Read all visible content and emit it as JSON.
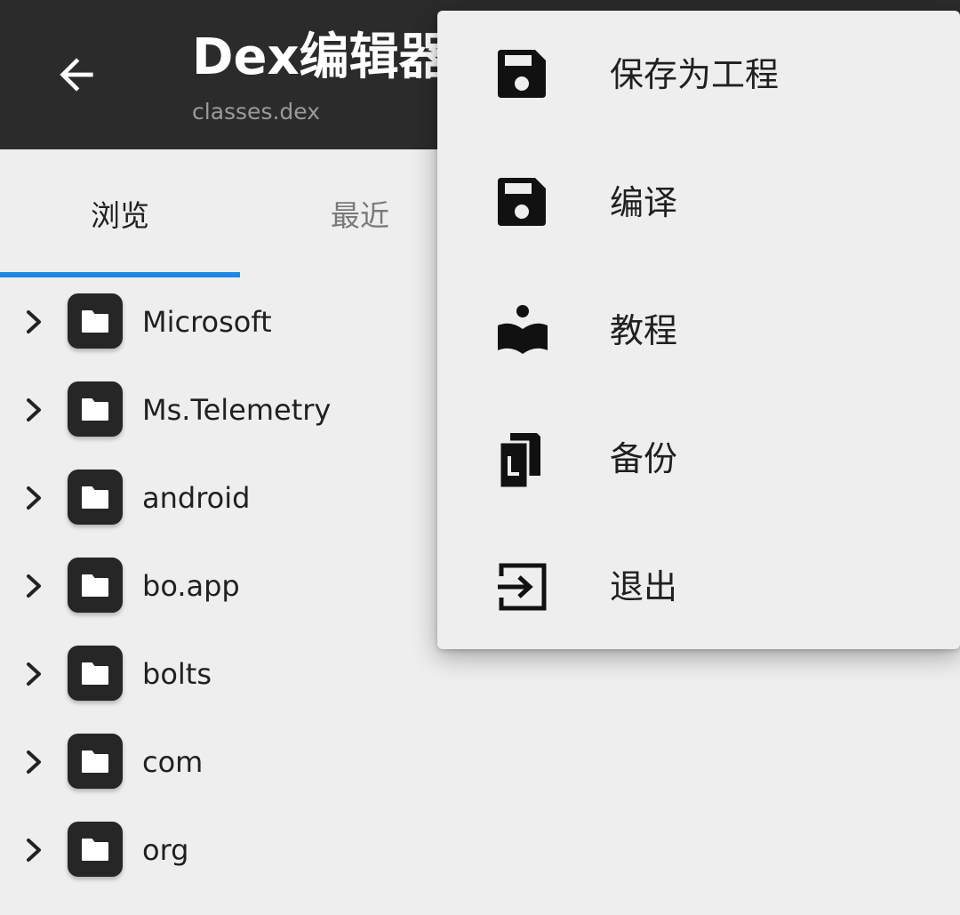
{
  "appbar": {
    "title": "Dex编辑器",
    "subtitle": "classes.dex",
    "back_icon": "arrow-back-icon",
    "background": "#2b2b2b"
  },
  "tabs": [
    {
      "label": "浏览",
      "selected": true
    },
    {
      "label": "最近",
      "selected": false
    }
  ],
  "accent_color": "#1e88e5",
  "tree": {
    "items": [
      {
        "label": "Microsoft"
      },
      {
        "label": "Ms.Telemetry"
      },
      {
        "label": "android"
      },
      {
        "label": "bo.app"
      },
      {
        "label": "bolts"
      },
      {
        "label": "com"
      },
      {
        "label": "org"
      }
    ],
    "expand_icon": "chevron-right-icon",
    "folder_icon": "folder-icon"
  },
  "menu": {
    "items": [
      {
        "label": "保存为工程",
        "icon": "save-icon"
      },
      {
        "label": "编译",
        "icon": "save-icon"
      },
      {
        "label": "教程",
        "icon": "book-reader-icon"
      },
      {
        "label": "备份",
        "icon": "file-copy-icon"
      },
      {
        "label": "退出",
        "icon": "exit-icon"
      }
    ]
  }
}
